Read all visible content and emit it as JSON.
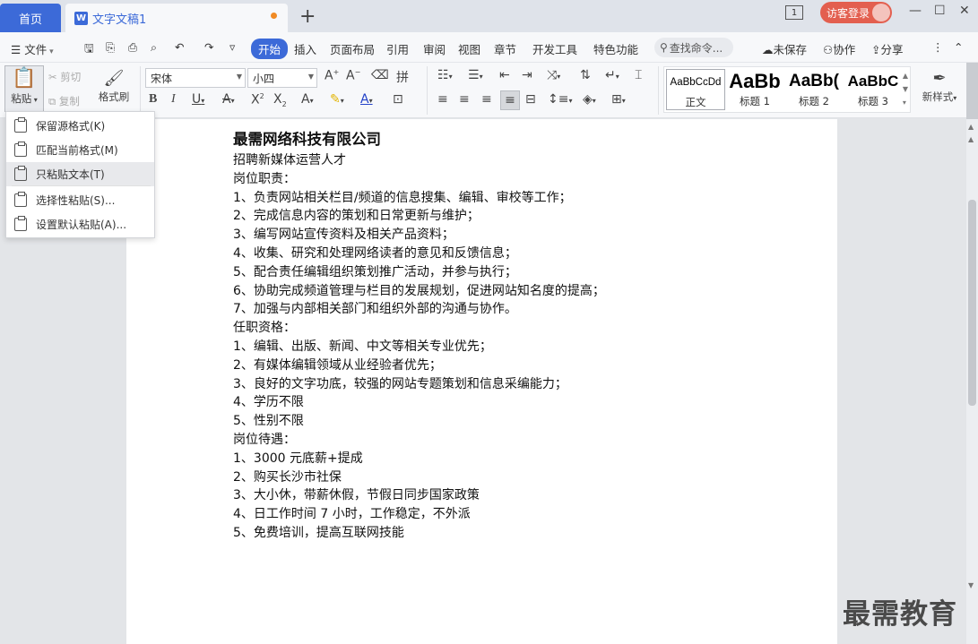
{
  "tabs": {
    "home": "首页",
    "doc": "文字文稿1",
    "new": "+"
  },
  "window": {
    "box_label": "1",
    "login": "访客登录",
    "minimize": "—",
    "maximize": "☐",
    "close": "✕"
  },
  "menu": {
    "file": "文件",
    "items": [
      "开始",
      "插入",
      "页面布局",
      "引用",
      "审阅",
      "视图",
      "章节",
      "开发工具",
      "特色功能"
    ],
    "search": "查找命令...",
    "unsaved": "未保存",
    "collab": "协作",
    "share": "分享"
  },
  "ribbon": {
    "paste": "粘贴",
    "cut": "剪切",
    "copy": "复制",
    "format_painter": "格式刷",
    "font_name": "宋体",
    "font_size": "小四",
    "styles": [
      {
        "preview": "AaBbCcDd",
        "label": "正文"
      },
      {
        "preview": "AaBb",
        "label": "标题 1"
      },
      {
        "preview": "AaBb(",
        "label": "标题 2"
      },
      {
        "preview": "AaBbC",
        "label": "标题 3"
      }
    ],
    "new_style": "新样式"
  },
  "paste_menu": {
    "items": [
      "保留源格式(K)",
      "匹配当前格式(M)",
      "只粘贴文本(T)",
      "选择性粘贴(S)...",
      "设置默认粘贴(A)..."
    ],
    "highlighted": 2
  },
  "document": {
    "title": "最需网络科技有限公司",
    "lines": [
      "招聘新媒体运营人才",
      "岗位职责：",
      "1、负责网站相关栏目/频道的信息搜集、编辑、审校等工作；",
      "2、完成信息内容的策划和日常更新与维护；",
      "3、编写网站宣传资料及相关产品资料；",
      "4、收集、研究和处理网络读者的意见和反馈信息；",
      "5、配合责任编辑组织策划推广活动，并参与执行；",
      "6、协助完成频道管理与栏目的发展规划，促进网站知名度的提高；",
      "7、加强与内部相关部门和组织外部的沟通与协作。",
      "任职资格：",
      "1、编辑、出版、新闻、中文等相关专业优先；",
      "2、有媒体编辑领域从业经验者优先；",
      "3、良好的文字功底，较强的网站专题策划和信息采编能力；",
      "4、学历不限",
      "5、性别不限",
      "岗位待遇：",
      "1、3000 元底薪+提成",
      "2、购买长沙市社保",
      "3、大小休，带薪休假，节假日同步国家政策",
      "4、日工作时间 7 小时，工作稳定，不外派",
      "5、免费培训，提高互联网技能"
    ]
  },
  "watermark": "最需教育"
}
